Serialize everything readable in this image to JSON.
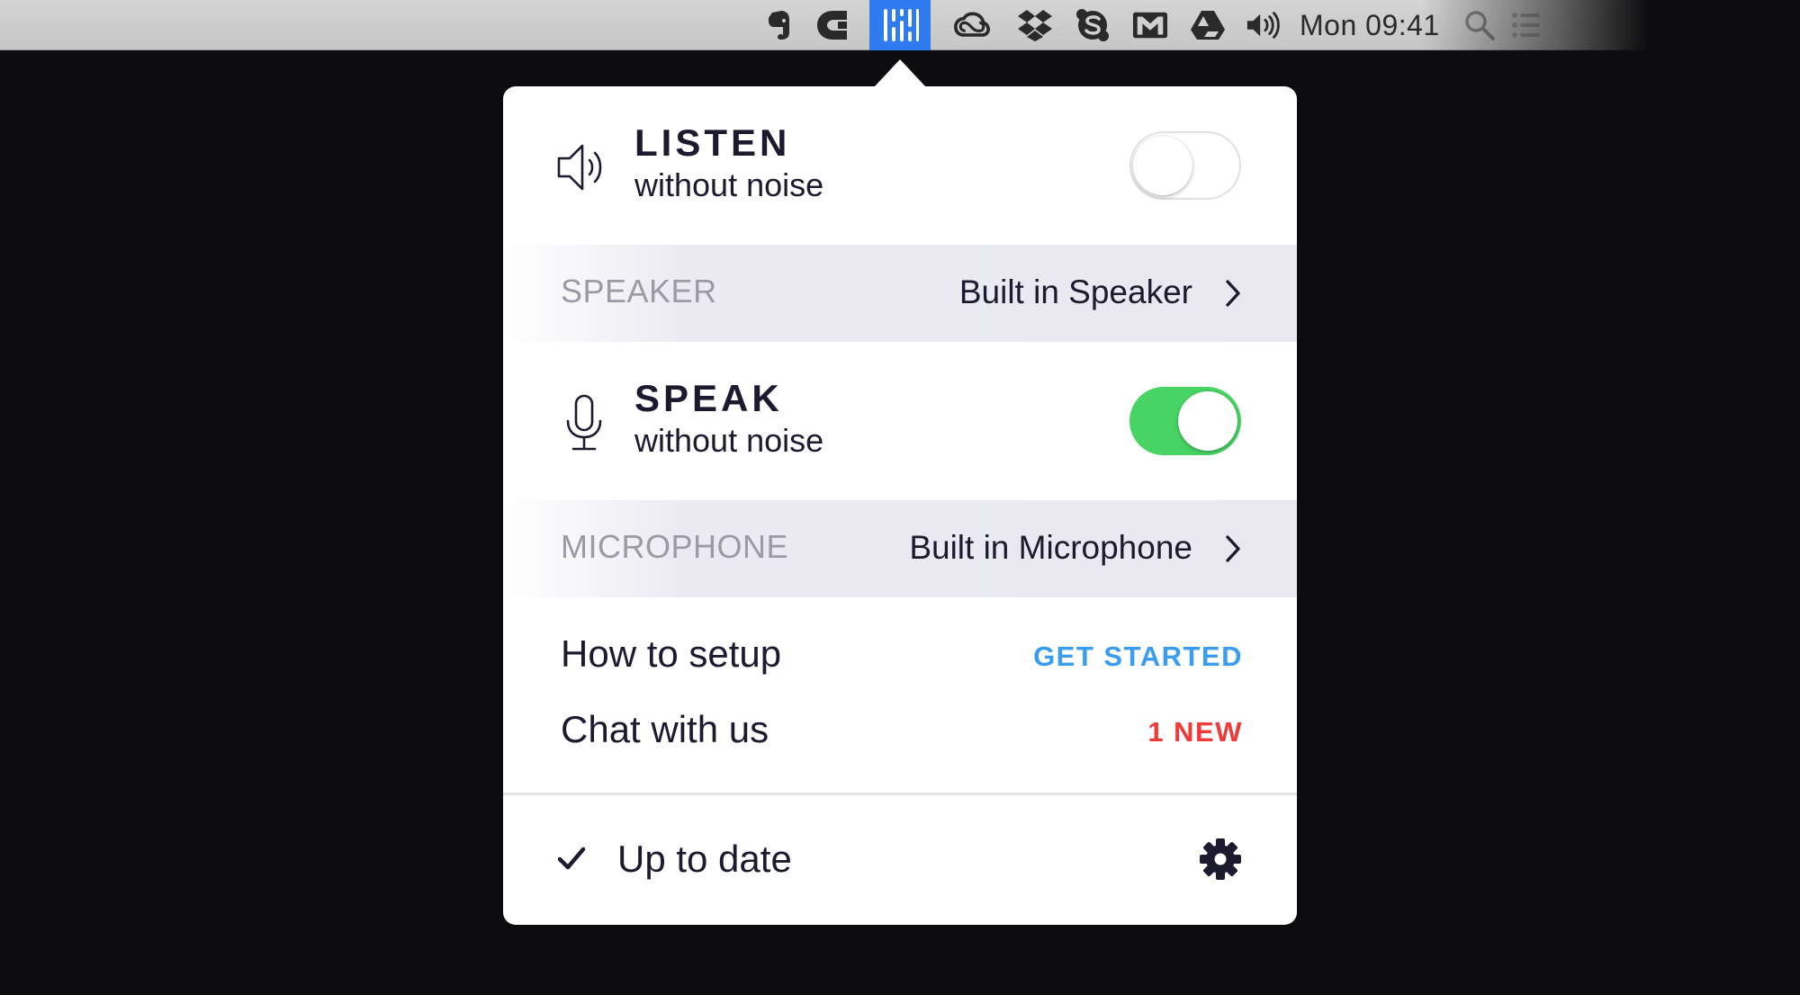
{
  "menubar": {
    "clock": "Mon 09:41",
    "icons": [
      "evernote-icon",
      "c-app-icon",
      "krisp-icon",
      "creative-cloud-icon",
      "dropbox-icon",
      "skype-icon",
      "mail-icon",
      "google-drive-icon",
      "volume-icon",
      "spotlight-icon",
      "notification-center-icon"
    ],
    "active_icon": "krisp-icon",
    "active_color": "#2f7bf0"
  },
  "popover": {
    "listen": {
      "title": "LISTEN",
      "subtitle": "without noise",
      "icon": "speaker-icon",
      "enabled": false
    },
    "speaker": {
      "label": "SPEAKER",
      "value": "Built in Speaker"
    },
    "speak": {
      "title": "SPEAK",
      "subtitle": "without noise",
      "icon": "microphone-icon",
      "enabled": true
    },
    "microphone": {
      "label": "MICROPHONE",
      "value": "Built in Microphone"
    },
    "links": {
      "setup_label": "How to setup",
      "setup_action": "GET STARTED",
      "setup_action_color": "#3a9df1",
      "chat_label": "Chat with us",
      "chat_action": "1 NEW",
      "chat_action_color": "#f03a3a"
    },
    "footer": {
      "status": "Up to date",
      "status_icon": "checkmark-icon",
      "settings_icon": "gear-icon"
    }
  },
  "colors": {
    "toggle_on": "#47d464",
    "text_primary": "#1b1a2e",
    "text_muted": "#9b9aa6"
  }
}
